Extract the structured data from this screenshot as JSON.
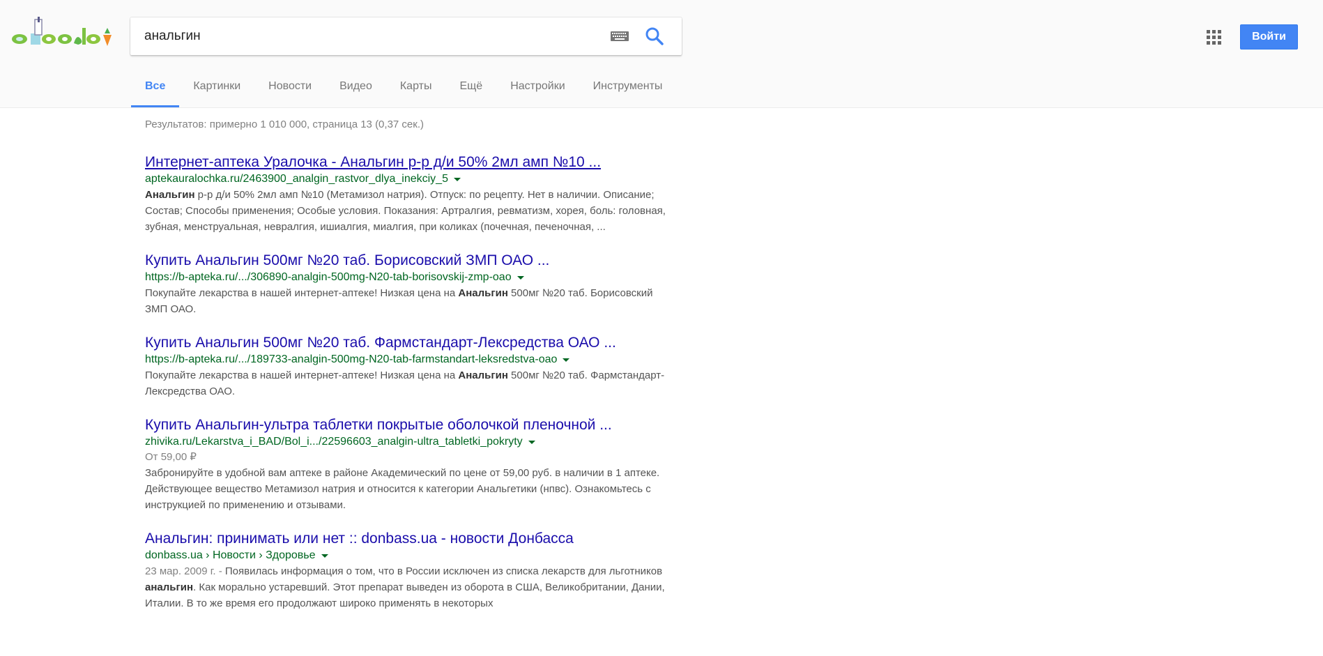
{
  "search": {
    "query": "анальгин"
  },
  "header": {
    "logo_icon": "doodle-logo",
    "keyboard_icon": "keyboard-icon",
    "search_icon": "search-icon",
    "apps_icon": "apps-grid-icon",
    "signin_label": "Войти",
    "accent": "#4285f4"
  },
  "tabs": [
    {
      "label": "Все",
      "active": true
    },
    {
      "label": "Картинки"
    },
    {
      "label": "Новости"
    },
    {
      "label": "Видео"
    },
    {
      "label": "Карты"
    },
    {
      "label": "Ещё"
    },
    {
      "label": "Настройки"
    },
    {
      "label": "Инструменты"
    }
  ],
  "stats": "Результатов: примерно 1 010 000, страница 13 (0,37 сек.)",
  "results": [
    {
      "title": "Интернет-аптека Уралочка - Анальгин р-р д/и 50% 2мл амп №10 ...",
      "url": "aptekauralochka.ru/2463900_analgin_rastvor_dlya_inekciy_5",
      "snippet_bold": "Анальгин",
      "snippet": " р-р д/и 50% 2мл амп №10 (Метамизол натрия). Отпуск: по рецепту. Нет в наличии. Описание; Состав; Способы применения; Особые условия. Показания: Артралгия, ревматизм, хорея, боль: головная, зубная, менструальная, невралгия, ишиалгия, миалгия, при коликах (почечная, печеночная, ..."
    },
    {
      "title": "Купить Анальгин 500мг №20 таб. Борисовский ЗМП ОАО ...",
      "url": "https://b-apteka.ru/.../306890-analgin-500mg-N20-tab-borisovskij-zmp-oao",
      "snippet_pre": "Покупайте лекарства в нашей интернет-аптеке! Низкая цена на ",
      "snippet_bold": "Анальгин",
      "snippet_post": " 500мг №20 таб. Борисовский ЗМП ОАО."
    },
    {
      "title": "Купить Анальгин 500мг №20 таб. Фармстандарт-Лексредства ОАО ...",
      "url": "https://b-apteka.ru/.../189733-analgin-500mg-N20-tab-farmstandart-leksredstva-oao",
      "snippet_pre": "Покупайте лекарства в нашей интернет-аптеке! Низкая цена на ",
      "snippet_bold": "Анальгин",
      "snippet_post": " 500мг №20 таб. Фармстандарт-Лексредства ОАО."
    },
    {
      "title": "Купить Анальгин-ультра таблетки покрытые оболочкой пленочной ...",
      "url": "zhivika.ru/Lekarstva_i_BAD/Bol_i.../22596603_analgin-ultra_tabletki_pokryty",
      "price": "От 59,00 ₽",
      "snippet": "Забронируйте в удобной вам аптеке в районе Академический по цене от 59,00 руб. в наличии в 1 аптеке. Действующее вещество Метамизол натрия и относится к категории Анальгетики (нпвс). Ознакомьтесь с инструкцией по применению и отзывами."
    },
    {
      "title": "Анальгин: принимать или нет :: donbass.ua - новости Донбасса",
      "url": "donbass.ua › Новости › Здоровье",
      "date": "23 мар. 2009 г. - ",
      "snippet_pre": "Появилась информация о том, что в России исключен из списка лекарств для льготников ",
      "snippet_bold": "анальгин",
      "snippet_post": ". Как морально устаревший. Этот препарат выведен из оборота в США, Великобритании, Дании, Италии. В то же время его продолжают широко применять в некоторых"
    }
  ]
}
